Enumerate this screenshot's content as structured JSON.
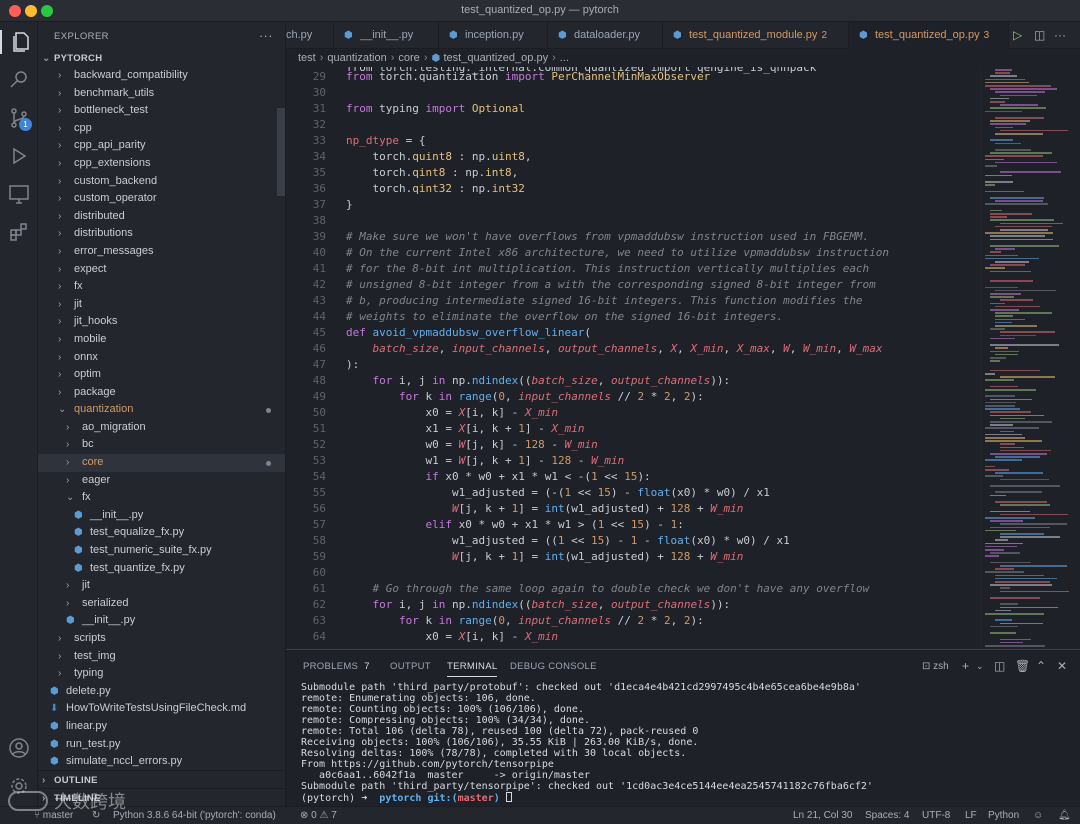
{
  "window": {
    "title": "test_quantized_op.py — pytorch"
  },
  "activity": {
    "source_control_badge": "1"
  },
  "explorer": {
    "header": "EXPLORER",
    "root": "PYTORCH",
    "items": [
      {
        "label": "backward_compatibility"
      },
      {
        "label": "benchmark_utils"
      },
      {
        "label": "bottleneck_test"
      },
      {
        "label": "cpp"
      },
      {
        "label": "cpp_api_parity"
      },
      {
        "label": "cpp_extensions"
      },
      {
        "label": "custom_backend"
      },
      {
        "label": "custom_operator"
      },
      {
        "label": "distributed"
      },
      {
        "label": "distributions"
      },
      {
        "label": "error_messages"
      },
      {
        "label": "expect"
      },
      {
        "label": "fx"
      },
      {
        "label": "jit"
      },
      {
        "label": "jit_hooks"
      },
      {
        "label": "mobile"
      },
      {
        "label": "onnx"
      },
      {
        "label": "optim"
      },
      {
        "label": "package"
      },
      {
        "label": "quantization"
      },
      {
        "label": "ao_migration"
      },
      {
        "label": "bc"
      },
      {
        "label": "core"
      },
      {
        "label": "eager"
      },
      {
        "label": "fx"
      },
      {
        "label": "__init__.py"
      },
      {
        "label": "test_equalize_fx.py"
      },
      {
        "label": "test_numeric_suite_fx.py"
      },
      {
        "label": "test_quantize_fx.py"
      },
      {
        "label": "jit"
      },
      {
        "label": "serialized"
      },
      {
        "label": "__init__.py"
      },
      {
        "label": "scripts"
      },
      {
        "label": "test_img"
      },
      {
        "label": "typing"
      },
      {
        "label": "delete.py"
      },
      {
        "label": "HowToWriteTestsUsingFileCheck.md"
      },
      {
        "label": "linear.py"
      },
      {
        "label": "run_test.py"
      },
      {
        "label": "simulate_nccl_errors.py"
      }
    ],
    "outline": "OUTLINE",
    "timeline": "TIMELINE"
  },
  "tabs": [
    {
      "label": "ch.py"
    },
    {
      "label": "__init__.py"
    },
    {
      "label": "inception.py"
    },
    {
      "label": "dataloader.py"
    },
    {
      "label": "test_quantized_module.py",
      "count": "2"
    },
    {
      "label": "test_quantized_op.py",
      "count": "3"
    }
  ],
  "breadcrumb": [
    "test",
    "quantization",
    "core",
    "test_quantized_op.py",
    "..."
  ],
  "editor": {
    "first_line": "from torch.testing._internal.common_quantized import qengine_is_qnnpack",
    "line_numbers": [
      "29",
      "30",
      "31",
      "32",
      "33",
      "34",
      "35",
      "36",
      "37",
      "38",
      "39",
      "40",
      "41",
      "42",
      "43",
      "44",
      "45",
      "46",
      "47",
      "48",
      "49",
      "50",
      "51",
      "52",
      "53",
      "54",
      "55",
      "56",
      "57",
      "58",
      "59",
      "60",
      "61",
      "62",
      "63",
      "64"
    ]
  },
  "panel": {
    "tabs": {
      "problems": "PROBLEMS",
      "problems_count": "7",
      "output": "OUTPUT",
      "terminal": "TERMINAL",
      "debug": "DEBUG CONSOLE"
    },
    "shell": "zsh",
    "terminal_lines": [
      "Submodule path 'third_party/protobuf': checked out 'd1eca4e4b421cd2997495c4b4e65cea6be4e9b8a'",
      "remote: Enumerating objects: 106, done.",
      "remote: Counting objects: 100% (106/106), done.",
      "remote: Compressing objects: 100% (34/34), done.",
      "remote: Total 106 (delta 78), reused 100 (delta 72), pack-reused 0",
      "Receiving objects: 100% (106/106), 35.55 KiB | 263.00 KiB/s, done.",
      "Resolving deltas: 100% (78/78), completed with 30 local objects.",
      "From https://github.com/pytorch/tensorpipe",
      "   a0c6aa1..6042f1a  master     -> origin/master",
      "Submodule path 'third_party/tensorpipe': checked out '1cd0ac3e4ce5144ee4ea2545741182c76fba6cf2'"
    ],
    "prompt": {
      "env": "(pytorch)",
      "arrow": "➜",
      "dir": "pytorch",
      "git": "git:(",
      "branch": "master",
      "close": ")"
    }
  },
  "status": {
    "branch": "master",
    "python": "Python 3.8.6 64-bit ('pytorch': conda)",
    "errors": "0",
    "warnings": "7",
    "position": "Ln 21, Col 30",
    "spaces": "Spaces: 4",
    "encoding": "UTF-8",
    "eol": "LF",
    "language": "Python"
  },
  "watermark": "大数跨境",
  "colors": {
    "keyword": "#c678dd",
    "function": "#61afef",
    "type": "#e5c07b",
    "variable": "#e06c75",
    "comment": "#7f848e",
    "number": "#d19a66",
    "accent": "#3f86d6"
  }
}
